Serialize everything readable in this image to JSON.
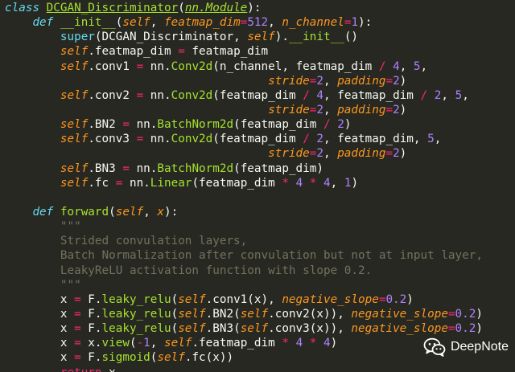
{
  "code": {
    "lines": [
      [
        [
          "kw",
          "class"
        ],
        [
          "plain",
          " "
        ],
        [
          "cls",
          "DCGAN_Discriminator"
        ],
        [
          "plain",
          "("
        ],
        [
          "inh",
          "nn.Module"
        ],
        [
          "plain",
          "):"
        ]
      ],
      [
        [
          "plain",
          "    "
        ],
        [
          "kw",
          "def"
        ],
        [
          "plain",
          " "
        ],
        [
          "def",
          "__init__"
        ],
        [
          "plain",
          "("
        ],
        [
          "self",
          "self"
        ],
        [
          "plain",
          ", "
        ],
        [
          "param",
          "featmap_dim"
        ],
        [
          "op",
          "="
        ],
        [
          "num",
          "512"
        ],
        [
          "plain",
          ", "
        ],
        [
          "param",
          "n_channel"
        ],
        [
          "op",
          "="
        ],
        [
          "num",
          "1"
        ],
        [
          "plain",
          "):"
        ]
      ],
      [
        [
          "plain",
          "        "
        ],
        [
          "call",
          "super"
        ],
        [
          "plain",
          "(DCGAN_Discriminator, "
        ],
        [
          "self",
          "self"
        ],
        [
          "plain",
          ")."
        ],
        [
          "def",
          "__init__"
        ],
        [
          "plain",
          "()"
        ]
      ],
      [
        [
          "plain",
          "        "
        ],
        [
          "self",
          "self"
        ],
        [
          "plain",
          ".featmap_dim "
        ],
        [
          "op",
          "="
        ],
        [
          "plain",
          " featmap_dim"
        ]
      ],
      [
        [
          "plain",
          "        "
        ],
        [
          "self",
          "self"
        ],
        [
          "plain",
          ".conv1 "
        ],
        [
          "op",
          "="
        ],
        [
          "plain",
          " nn."
        ],
        [
          "attr",
          "Conv2d"
        ],
        [
          "plain",
          "(n_channel, featmap_dim "
        ],
        [
          "op",
          "/"
        ],
        [
          "plain",
          " "
        ],
        [
          "num",
          "4"
        ],
        [
          "plain",
          ", "
        ],
        [
          "num",
          "5"
        ],
        [
          "plain",
          ","
        ]
      ],
      [
        [
          "plain",
          "                                      "
        ],
        [
          "param",
          "stride"
        ],
        [
          "op",
          "="
        ],
        [
          "num",
          "2"
        ],
        [
          "plain",
          ", "
        ],
        [
          "param",
          "padding"
        ],
        [
          "op",
          "="
        ],
        [
          "num",
          "2"
        ],
        [
          "plain",
          ")"
        ]
      ],
      [
        [
          "plain",
          "        "
        ],
        [
          "self",
          "self"
        ],
        [
          "plain",
          ".conv2 "
        ],
        [
          "op",
          "="
        ],
        [
          "plain",
          " nn."
        ],
        [
          "attr",
          "Conv2d"
        ],
        [
          "plain",
          "(featmap_dim "
        ],
        [
          "op",
          "/"
        ],
        [
          "plain",
          " "
        ],
        [
          "num",
          "4"
        ],
        [
          "plain",
          ", featmap_dim "
        ],
        [
          "op",
          "/"
        ],
        [
          "plain",
          " "
        ],
        [
          "num",
          "2"
        ],
        [
          "plain",
          ", "
        ],
        [
          "num",
          "5"
        ],
        [
          "plain",
          ","
        ]
      ],
      [
        [
          "plain",
          "                                      "
        ],
        [
          "param",
          "stride"
        ],
        [
          "op",
          "="
        ],
        [
          "num",
          "2"
        ],
        [
          "plain",
          ", "
        ],
        [
          "param",
          "padding"
        ],
        [
          "op",
          "="
        ],
        [
          "num",
          "2"
        ],
        [
          "plain",
          ")"
        ]
      ],
      [
        [
          "plain",
          "        "
        ],
        [
          "self",
          "self"
        ],
        [
          "plain",
          ".BN2 "
        ],
        [
          "op",
          "="
        ],
        [
          "plain",
          " nn."
        ],
        [
          "attr",
          "BatchNorm2d"
        ],
        [
          "plain",
          "(featmap_dim "
        ],
        [
          "op",
          "/"
        ],
        [
          "plain",
          " "
        ],
        [
          "num",
          "2"
        ],
        [
          "plain",
          ")"
        ]
      ],
      [
        [
          "plain",
          "        "
        ],
        [
          "self",
          "self"
        ],
        [
          "plain",
          ".conv3 "
        ],
        [
          "op",
          "="
        ],
        [
          "plain",
          " nn."
        ],
        [
          "attr",
          "Conv2d"
        ],
        [
          "plain",
          "(featmap_dim "
        ],
        [
          "op",
          "/"
        ],
        [
          "plain",
          " "
        ],
        [
          "num",
          "2"
        ],
        [
          "plain",
          ", featmap_dim, "
        ],
        [
          "num",
          "5"
        ],
        [
          "plain",
          ","
        ]
      ],
      [
        [
          "plain",
          "                                      "
        ],
        [
          "param",
          "stride"
        ],
        [
          "op",
          "="
        ],
        [
          "num",
          "2"
        ],
        [
          "plain",
          ", "
        ],
        [
          "param",
          "padding"
        ],
        [
          "op",
          "="
        ],
        [
          "num",
          "2"
        ],
        [
          "plain",
          ")"
        ]
      ],
      [
        [
          "plain",
          "        "
        ],
        [
          "self",
          "self"
        ],
        [
          "plain",
          ".BN3 "
        ],
        [
          "op",
          "="
        ],
        [
          "plain",
          " nn."
        ],
        [
          "attr",
          "BatchNorm2d"
        ],
        [
          "plain",
          "(featmap_dim)"
        ]
      ],
      [
        [
          "plain",
          "        "
        ],
        [
          "self",
          "self"
        ],
        [
          "plain",
          ".fc "
        ],
        [
          "op",
          "="
        ],
        [
          "plain",
          " nn."
        ],
        [
          "attr",
          "Linear"
        ],
        [
          "plain",
          "(featmap_dim "
        ],
        [
          "op",
          "*"
        ],
        [
          "plain",
          " "
        ],
        [
          "num",
          "4"
        ],
        [
          "plain",
          " "
        ],
        [
          "op",
          "*"
        ],
        [
          "plain",
          " "
        ],
        [
          "num",
          "4"
        ],
        [
          "plain",
          ", "
        ],
        [
          "num",
          "1"
        ],
        [
          "plain",
          ")"
        ]
      ],
      [],
      [
        [
          "plain",
          "    "
        ],
        [
          "kw",
          "def"
        ],
        [
          "plain",
          " "
        ],
        [
          "def",
          "forward"
        ],
        [
          "plain",
          "("
        ],
        [
          "self",
          "self"
        ],
        [
          "plain",
          ", "
        ],
        [
          "param",
          "x"
        ],
        [
          "plain",
          "):"
        ]
      ],
      [
        [
          "plain",
          "        "
        ],
        [
          "doc",
          "\"\"\""
        ]
      ],
      [
        [
          "plain",
          "        "
        ],
        [
          "doc",
          "Strided convulation layers,"
        ]
      ],
      [
        [
          "plain",
          "        "
        ],
        [
          "doc",
          "Batch Normalization after convulation but not at input layer,"
        ]
      ],
      [
        [
          "plain",
          "        "
        ],
        [
          "doc",
          "LeakyReLU activation function with slope 0.2."
        ]
      ],
      [
        [
          "plain",
          "        "
        ],
        [
          "doc",
          "\"\"\""
        ]
      ],
      [
        [
          "plain",
          "        x "
        ],
        [
          "op",
          "="
        ],
        [
          "plain",
          " F."
        ],
        [
          "attr",
          "leaky_relu"
        ],
        [
          "plain",
          "("
        ],
        [
          "self",
          "self"
        ],
        [
          "plain",
          ".conv1(x), "
        ],
        [
          "param",
          "negative_slope"
        ],
        [
          "op",
          "="
        ],
        [
          "num",
          "0.2"
        ],
        [
          "plain",
          ")"
        ]
      ],
      [
        [
          "plain",
          "        x "
        ],
        [
          "op",
          "="
        ],
        [
          "plain",
          " F."
        ],
        [
          "attr",
          "leaky_relu"
        ],
        [
          "plain",
          "("
        ],
        [
          "self",
          "self"
        ],
        [
          "plain",
          ".BN2("
        ],
        [
          "self",
          "self"
        ],
        [
          "plain",
          ".conv2(x)), "
        ],
        [
          "param",
          "negative_slope"
        ],
        [
          "op",
          "="
        ],
        [
          "num",
          "0.2"
        ],
        [
          "plain",
          ")"
        ]
      ],
      [
        [
          "plain",
          "        x "
        ],
        [
          "op",
          "="
        ],
        [
          "plain",
          " F."
        ],
        [
          "attr",
          "leaky_relu"
        ],
        [
          "plain",
          "("
        ],
        [
          "self",
          "self"
        ],
        [
          "plain",
          ".BN3("
        ],
        [
          "self",
          "self"
        ],
        [
          "plain",
          ".conv3(x)), "
        ],
        [
          "param",
          "negative_slope"
        ],
        [
          "op",
          "="
        ],
        [
          "num",
          "0.2"
        ],
        [
          "plain",
          ")"
        ]
      ],
      [
        [
          "plain",
          "        x "
        ],
        [
          "op",
          "="
        ],
        [
          "plain",
          " x."
        ],
        [
          "attr",
          "view"
        ],
        [
          "plain",
          "("
        ],
        [
          "op",
          "-"
        ],
        [
          "num",
          "1"
        ],
        [
          "plain",
          ", "
        ],
        [
          "self",
          "self"
        ],
        [
          "plain",
          ".featmap_dim "
        ],
        [
          "op",
          "*"
        ],
        [
          "plain",
          " "
        ],
        [
          "num",
          "4"
        ],
        [
          "plain",
          " "
        ],
        [
          "op",
          "*"
        ],
        [
          "plain",
          " "
        ],
        [
          "num",
          "4"
        ],
        [
          "plain",
          ")"
        ]
      ],
      [
        [
          "plain",
          "        x "
        ],
        [
          "op",
          "="
        ],
        [
          "plain",
          " F."
        ],
        [
          "attr",
          "sigmoid"
        ],
        [
          "plain",
          "("
        ],
        [
          "self",
          "self"
        ],
        [
          "plain",
          ".fc(x))"
        ]
      ],
      [
        [
          "plain",
          "        "
        ],
        [
          "ret",
          "return"
        ],
        [
          "plain",
          " x"
        ]
      ]
    ]
  },
  "watermark": {
    "text": "DeepNote",
    "icon": "wechat-icon",
    "icon_color": "#ffffff"
  },
  "theme": {
    "background": "#272822",
    "keyword": "#66d9ef",
    "function": "#a6e22e",
    "self": "#fd971f",
    "operator": "#f92672",
    "number": "#ae81ff",
    "comment": "#75715e",
    "text": "#f8f8f2"
  }
}
